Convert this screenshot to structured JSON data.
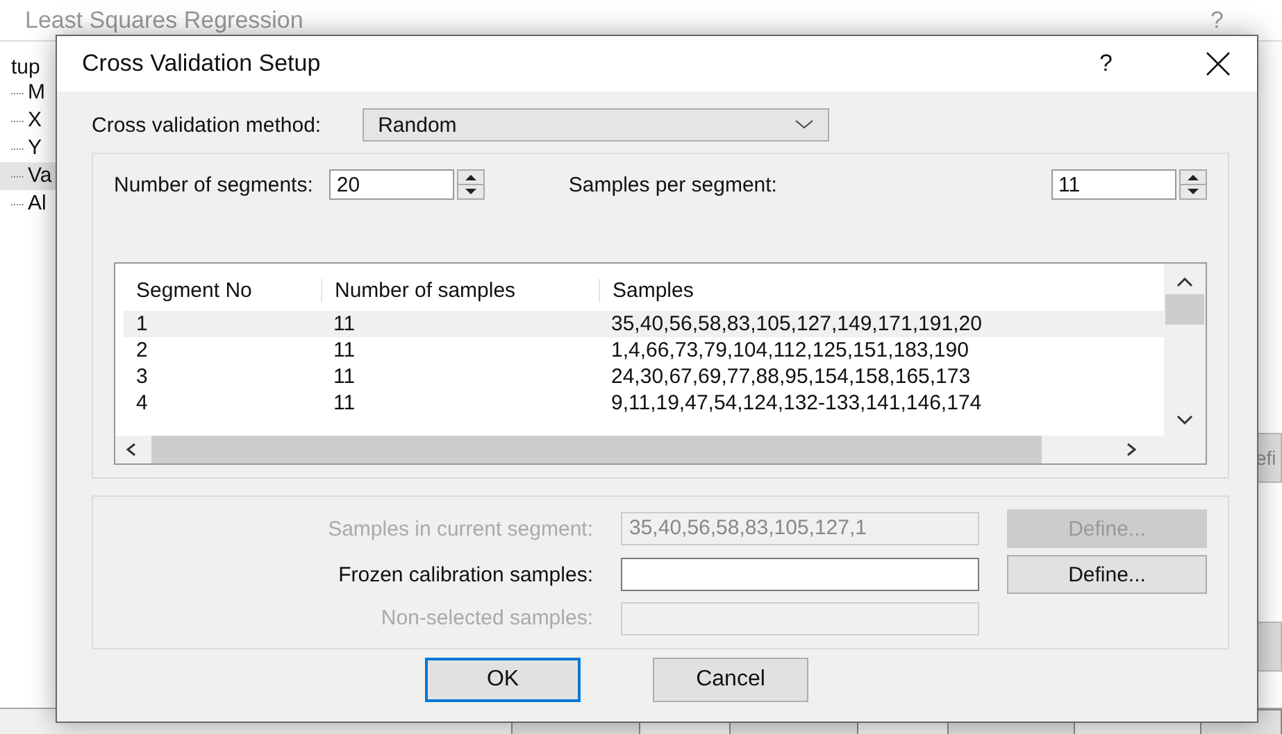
{
  "background_window": {
    "title": "Least Squares Regression",
    "help": "?",
    "tree": {
      "label": "tup",
      "children": [
        {
          "label": "M",
          "selected": false
        },
        {
          "label": "X",
          "selected": false
        },
        {
          "label": "Y",
          "selected": false
        },
        {
          "label": "Va",
          "selected": true
        },
        {
          "label": "Al",
          "selected": false
        }
      ]
    },
    "side_button": {
      "label": "efi"
    }
  },
  "dialog": {
    "title": "Cross Validation Setup",
    "help": "?",
    "method": {
      "label": "Cross validation method:",
      "value": "Random"
    },
    "segments": {
      "label": "Number of segments:",
      "value": "20"
    },
    "per_segment": {
      "label": "Samples per segment:",
      "value": "11"
    },
    "table": {
      "columns": [
        "Segment No",
        "Number of samples",
        "Samples"
      ],
      "rows": [
        {
          "cells": [
            "1",
            "11",
            "35,40,56,58,83,105,127,149,171,191,20"
          ],
          "selected": true
        },
        {
          "cells": [
            "2",
            "11",
            "1,4,66,73,79,104,112,125,151,183,190"
          ],
          "selected": false
        },
        {
          "cells": [
            "3",
            "11",
            "24,30,67,69,77,88,95,154,158,165,173"
          ],
          "selected": false
        },
        {
          "cells": [
            "4",
            "11",
            "9,11,19,47,54,124,132-133,141,146,174"
          ],
          "selected": false
        }
      ]
    },
    "fields": [
      {
        "label": "Samples in current segment:",
        "value": "35,40,56,58,83,105,127,1",
        "disabled": true,
        "button": {
          "label": "Define...",
          "disabled": true
        }
      },
      {
        "label": "Frozen calibration samples:",
        "disabled": false,
        "button": {
          "label": "Define...",
          "disabled": false
        }
      },
      {
        "label": "Non-selected samples:",
        "disabled": true
      }
    ],
    "buttons": [
      {
        "label": "OK",
        "default": true
      },
      {
        "label": "Cancel",
        "default": false
      }
    ]
  }
}
